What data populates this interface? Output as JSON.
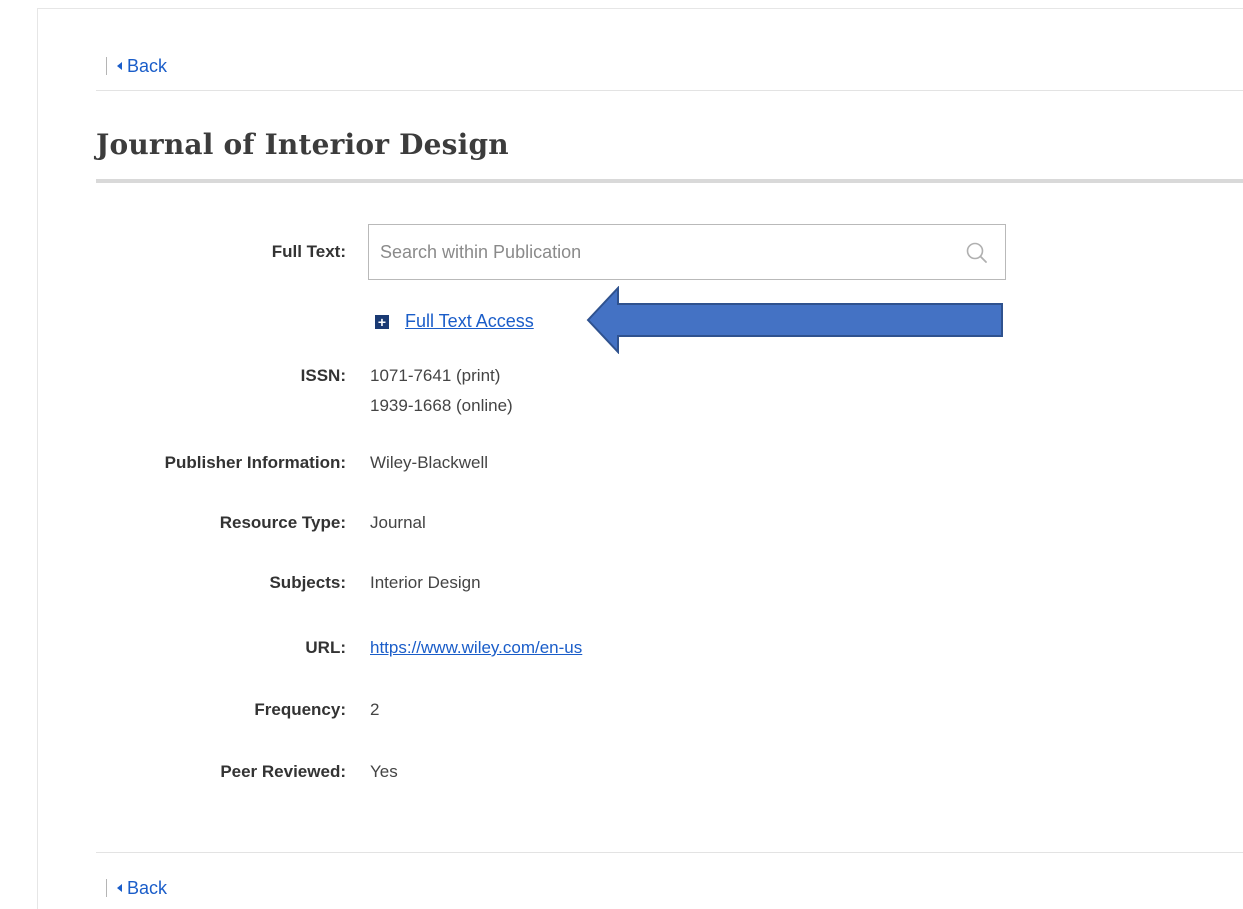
{
  "back_label_top": "Back",
  "back_label_bottom": "Back",
  "title": "Journal of Interior Design",
  "search": {
    "label": "Full Text:",
    "placeholder": "Search within Publication",
    "value": ""
  },
  "full_text_access": {
    "icon": "plus-icon",
    "label": "Full Text Access"
  },
  "details": {
    "issn_label": "ISSN:",
    "issn_print": "1071-7641 (print)",
    "issn_online": "1939-1668 (online)",
    "publisher_label": "Publisher Information:",
    "publisher_value": "Wiley-Blackwell",
    "resource_type_label": "Resource Type:",
    "resource_type_value": "Journal",
    "subjects_label": "Subjects:",
    "subjects_value": "Interior Design",
    "url_label": "URL:",
    "url_value": "https://www.wiley.com/en-us",
    "frequency_label": "Frequency:",
    "frequency_value": "2",
    "peer_reviewed_label": "Peer Reviewed:",
    "peer_reviewed_value": "Yes"
  },
  "colors": {
    "link": "#1a5dc9",
    "annotation_arrow": "#4472c4",
    "annotation_arrow_border": "#2f528f",
    "plus_icon_bg": "#1a3a73"
  }
}
